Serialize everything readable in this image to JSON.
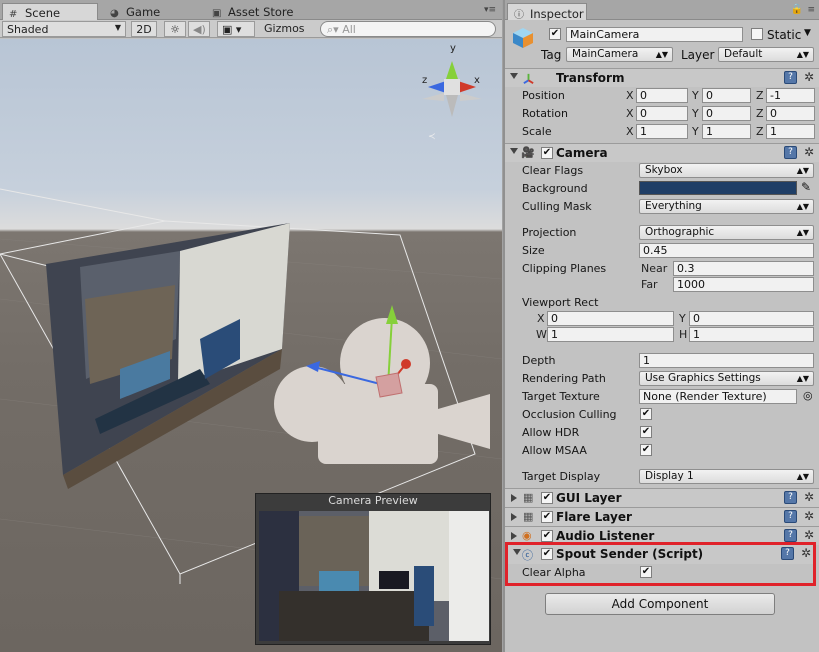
{
  "scene": {
    "tabs": [
      {
        "label": "Scene",
        "icon": "hash-icon"
      },
      {
        "label": "Game",
        "icon": "pacman-icon"
      },
      {
        "label": "Asset Store",
        "icon": "bag-icon"
      }
    ],
    "toolbar": {
      "shading": "Shaded",
      "mode_2d": "2D",
      "gizmos": "Gizmos",
      "search_placeholder": "All"
    },
    "camera_preview_title": "Camera Preview",
    "gizmo_axes": {
      "x": "x",
      "y": "y",
      "z": "z"
    }
  },
  "inspector": {
    "tab_label": "Inspector",
    "object_name": "MainCamera",
    "static_label": "Static",
    "tag_label": "Tag",
    "tag_value": "MainCamera",
    "layer_label": "Layer",
    "layer_value": "Default",
    "transform": {
      "title": "Transform",
      "position_label": "Position",
      "rotation_label": "Rotation",
      "scale_label": "Scale",
      "axis_labels": [
        "X",
        "Y",
        "Z"
      ],
      "position": [
        "0",
        "0",
        "-1"
      ],
      "rotation": [
        "0",
        "0",
        "0"
      ],
      "scale": [
        "1",
        "1",
        "1"
      ]
    },
    "camera": {
      "title": "Camera",
      "clear_flags_label": "Clear Flags",
      "clear_flags": "Skybox",
      "background_label": "Background",
      "background_color": "#1f3e66",
      "culling_mask_label": "Culling Mask",
      "culling_mask": "Everything",
      "projection_label": "Projection",
      "projection": "Orthographic",
      "size_label": "Size",
      "size": "0.45",
      "clipping_label": "Clipping Planes",
      "near_label": "Near",
      "near": "0.3",
      "far_label": "Far",
      "far": "1000",
      "viewport_label": "Viewport Rect",
      "vp_x_label": "X",
      "vp_x": "0",
      "vp_y_label": "Y",
      "vp_y": "0",
      "vp_w_label": "W",
      "vp_w": "1",
      "vp_h_label": "H",
      "vp_h": "1",
      "depth_label": "Depth",
      "depth": "1",
      "rendering_path_label": "Rendering Path",
      "rendering_path": "Use Graphics Settings",
      "target_texture_label": "Target Texture",
      "target_texture": "None (Render Texture)",
      "occlusion_label": "Occlusion Culling",
      "hdr_label": "Allow HDR",
      "msaa_label": "Allow MSAA",
      "target_display_label": "Target Display",
      "target_display": "Display 1"
    },
    "components": [
      {
        "title": "GUI Layer"
      },
      {
        "title": "Flare Layer"
      },
      {
        "title": "Audio Listener"
      }
    ],
    "spout": {
      "title": "Spout Sender (Script)",
      "clear_alpha_label": "Clear Alpha",
      "highlight_color": "#e0222a"
    },
    "add_component": "Add Component"
  },
  "colors": {
    "panel_bg": "#c2c2c2",
    "help_icon": "#5577a8"
  }
}
